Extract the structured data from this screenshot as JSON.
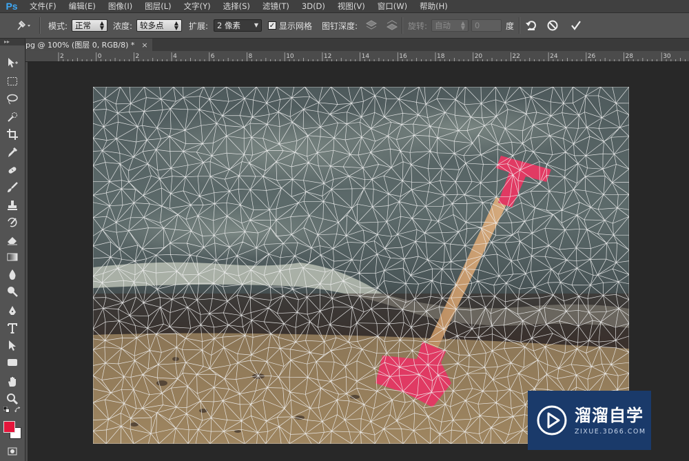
{
  "app": {
    "logo": "Ps",
    "menu": [
      "文件(F)",
      "编辑(E)",
      "图像(I)",
      "图层(L)",
      "文字(Y)",
      "选择(S)",
      "滤镜(T)",
      "3D(D)",
      "视图(V)",
      "窗口(W)",
      "帮助(H)"
    ]
  },
  "options": {
    "mode_label": "模式:",
    "mode_value": "正常",
    "density_label": "浓度:",
    "density_value": "较多点",
    "expand_label": "扩展:",
    "expand_value": "2 像素",
    "show_mesh_label": "显示网格",
    "show_mesh_checked": true,
    "pin_depth_label": "图钉深度:",
    "rotate_label": "旋转:",
    "rotate_value": "自动",
    "rotate_degree_value": "0",
    "degree_unit": "度"
  },
  "document": {
    "tab_title": "pg @ 100% (图层 0, RGB/8) *",
    "close_glyph": "×"
  },
  "ruler": {
    "top_labels": [
      "2",
      "0",
      "2",
      "4",
      "6",
      "8",
      "10",
      "12",
      "14",
      "16",
      "18",
      "20",
      "22",
      "24",
      "26",
      "28",
      "30"
    ]
  },
  "watermark": {
    "title": "溜溜自学",
    "subtitle": "ZIXUE.3D66.COM"
  },
  "colors": {
    "foreground": "#e5163b",
    "background": "#ffffff",
    "accent": "#3ea8f5"
  },
  "icons": {
    "puppet_pin_tool": "pin-icon",
    "reset": "reset-icon",
    "cancel": "cancel-icon",
    "commit": "checkmark-icon"
  }
}
